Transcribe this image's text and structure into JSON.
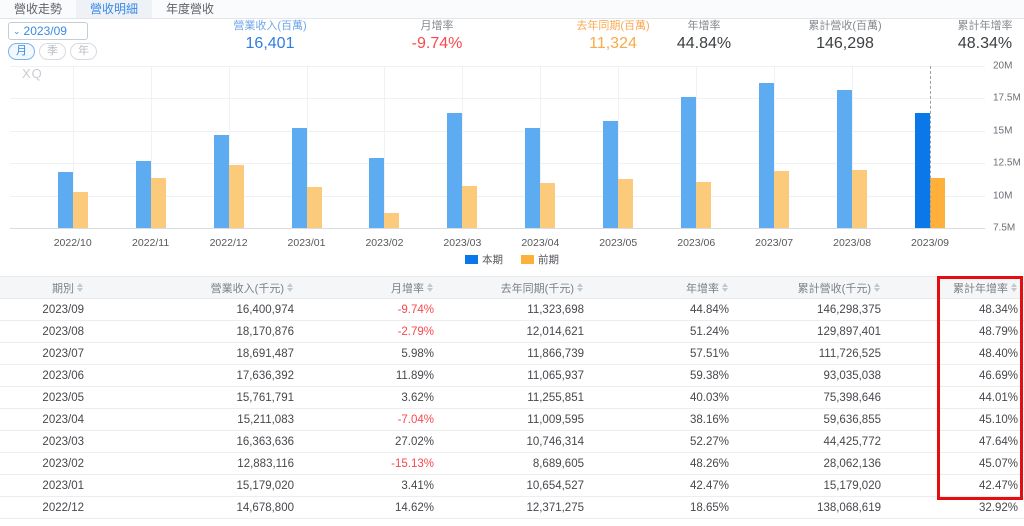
{
  "tabs": [
    {
      "label": "營收走勢",
      "active": false
    },
    {
      "label": "營收明細",
      "active": true
    },
    {
      "label": "年度營收",
      "active": false
    }
  ],
  "controls": {
    "period_value": "2023/09",
    "chevron_icon": "⌄",
    "freq_options": [
      {
        "label": "月",
        "active": true
      },
      {
        "label": "季",
        "active": false
      },
      {
        "label": "年",
        "active": false
      }
    ]
  },
  "stats": [
    {
      "label": "營業收入(百萬)",
      "value": "16,401",
      "label_color": "#6fa7e8",
      "value_color": "#2e7de0"
    },
    {
      "label": "月增率",
      "value": "-9.74%",
      "label_color": "#85898f",
      "value_color": "#f8484e"
    },
    {
      "label": "去年同期(百萬)",
      "value": "11,324",
      "label_color": "#f9ab54",
      "value_color": "#f9a945"
    },
    {
      "label": "年增率",
      "value": "44.84%",
      "label_color": "#85898f",
      "value_color": "#3c4043"
    },
    {
      "label": "累計營收(百萬)",
      "value": "146,298",
      "label_color": "#85898f",
      "value_color": "#3c4043"
    },
    {
      "label": "累計年增率",
      "value": "48.34%",
      "label_color": "#85898f",
      "value_color": "#3c4043"
    }
  ],
  "chart_data": {
    "type": "bar",
    "watermark": "XQ",
    "unit": "M (chart axis, thousand TWD ×1e6)",
    "categories": [
      "2022/10",
      "2022/11",
      "2022/12",
      "2023/01",
      "2023/02",
      "2023/03",
      "2023/04",
      "2023/05",
      "2023/06",
      "2023/07",
      "2023/08",
      "2023/09"
    ],
    "series": [
      {
        "name": "本期",
        "color": "#5dacf1",
        "highlight_color": "#0a78e8",
        "values": [
          11.8,
          12.7,
          14.68,
          15.18,
          12.88,
          16.36,
          15.21,
          15.76,
          17.64,
          18.69,
          18.17,
          16.4
        ]
      },
      {
        "name": "前期",
        "color": "#fbca7b",
        "highlight_color": "#ffb03a",
        "values": [
          10.3,
          11.35,
          12.37,
          10.65,
          8.69,
          10.75,
          11.01,
          11.26,
          11.07,
          11.87,
          12.01,
          11.32
        ]
      }
    ],
    "highlight_index": 11,
    "ylim": [
      7.5,
      20
    ],
    "yticks": [
      {
        "label": "20M",
        "value": 20
      },
      {
        "label": "17.5M",
        "value": 17.5
      },
      {
        "label": "15M",
        "value": 15
      },
      {
        "label": "12.5M",
        "value": 12.5
      },
      {
        "label": "10M",
        "value": 10
      },
      {
        "label": "7.5M",
        "value": 7.5
      }
    ],
    "grid": true,
    "legend_position": "bottom"
  },
  "table": {
    "columns": [
      "期別",
      "營業收入(千元)",
      "月增率",
      "去年同期(千元)",
      "年增率",
      "累計營收(千元)",
      "累計年增率"
    ],
    "rows": [
      [
        "2023/09",
        "16,400,974",
        "-9.74%",
        "11,323,698",
        "44.84%",
        "146,298,375",
        "48.34%"
      ],
      [
        "2023/08",
        "18,170,876",
        "-2.79%",
        "12,014,621",
        "51.24%",
        "129,897,401",
        "48.79%"
      ],
      [
        "2023/07",
        "18,691,487",
        "5.98%",
        "11,866,739",
        "57.51%",
        "111,726,525",
        "48.40%"
      ],
      [
        "2023/06",
        "17,636,392",
        "11.89%",
        "11,065,937",
        "59.38%",
        "93,035,038",
        "46.69%"
      ],
      [
        "2023/05",
        "15,761,791",
        "3.62%",
        "11,255,851",
        "40.03%",
        "75,398,646",
        "44.01%"
      ],
      [
        "2023/04",
        "15,211,083",
        "-7.04%",
        "11,009,595",
        "38.16%",
        "59,636,855",
        "45.10%"
      ],
      [
        "2023/03",
        "16,363,636",
        "27.02%",
        "10,746,314",
        "52.27%",
        "44,425,772",
        "47.64%"
      ],
      [
        "2023/02",
        "12,883,116",
        "-15.13%",
        "8,689,605",
        "48.26%",
        "28,062,136",
        "45.07%"
      ],
      [
        "2023/01",
        "15,179,020",
        "3.41%",
        "10,654,527",
        "42.47%",
        "15,179,020",
        "42.47%"
      ],
      [
        "2022/12",
        "14,678,800",
        "14.62%",
        "12,371,275",
        "18.65%",
        "138,068,619",
        "32.92%"
      ]
    ],
    "negative_color": "#f8484e"
  },
  "annotation": {
    "highlight_box_color": "#e60c10"
  }
}
